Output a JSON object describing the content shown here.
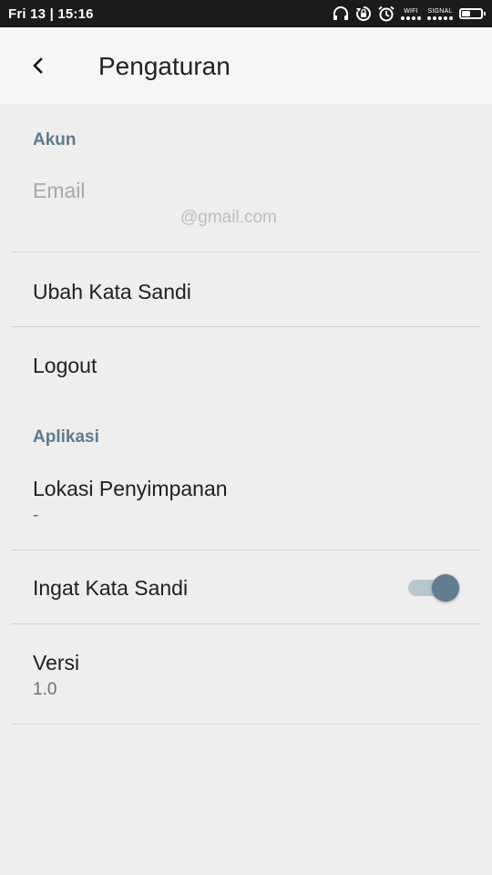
{
  "status_bar": {
    "time": "Fri 13 | 15:16",
    "icons": [
      "headphones-icon",
      "rotation-lock-icon",
      "alarm-icon",
      "wifi-icon",
      "signal-icon",
      "battery-icon"
    ],
    "wifi_label": "WIFI",
    "signal_label": "SIGNAL",
    "battery_level": 0.45
  },
  "app_bar": {
    "back_icon": "back-arrow-icon",
    "title": "Pengaturan"
  },
  "sections": {
    "account": {
      "header": "Akun",
      "email_title": "Email",
      "email_value": "@gmail.com",
      "change_password": "Ubah Kata Sandi",
      "logout": "Logout"
    },
    "app": {
      "header": "Aplikasi",
      "storage_title": "Lokasi Penyimpanan",
      "storage_value": "-",
      "remember_password": "Ingat Kata Sandi",
      "remember_password_on": true,
      "version_title": "Versi",
      "version_value": "1.0"
    }
  },
  "colors": {
    "accent": "#5e7a8c",
    "toggle_thumb": "#627d8f",
    "toggle_track": "#b9c6ce",
    "background": "#eeeeee",
    "app_bar": "#f6f6f6",
    "status_bar": "#1b1b1b"
  }
}
